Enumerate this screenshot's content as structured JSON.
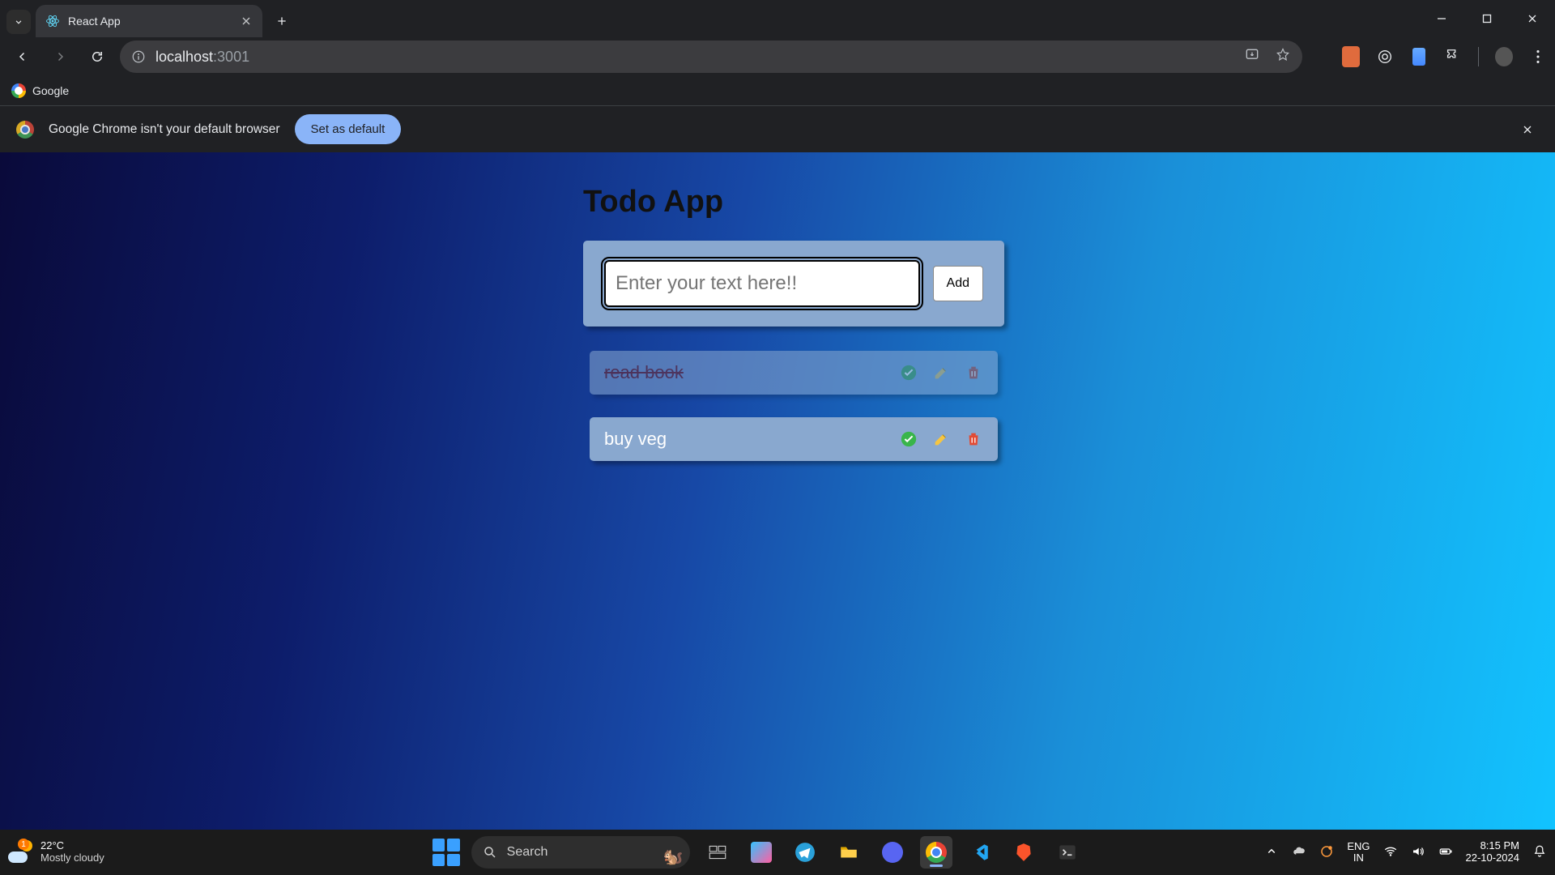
{
  "browser": {
    "tab_title": "React App",
    "url_host": "localhost",
    "url_port": ":3001",
    "bookmark_google": "Google",
    "infobar_text": "Google Chrome isn't your default browser",
    "set_default_label": "Set as default"
  },
  "app": {
    "title": "Todo App",
    "input_placeholder": "Enter your text here!!",
    "add_label": "Add",
    "todos": [
      {
        "text": "read book",
        "done": true
      },
      {
        "text": "buy veg",
        "done": false
      }
    ]
  },
  "taskbar": {
    "weather_temp": "22°C",
    "weather_desc": "Mostly cloudy",
    "weather_badge": "1",
    "search_placeholder": "Search",
    "lang_top": "ENG",
    "lang_bottom": "IN",
    "time": "8:15 PM",
    "date": "22-10-2024"
  }
}
